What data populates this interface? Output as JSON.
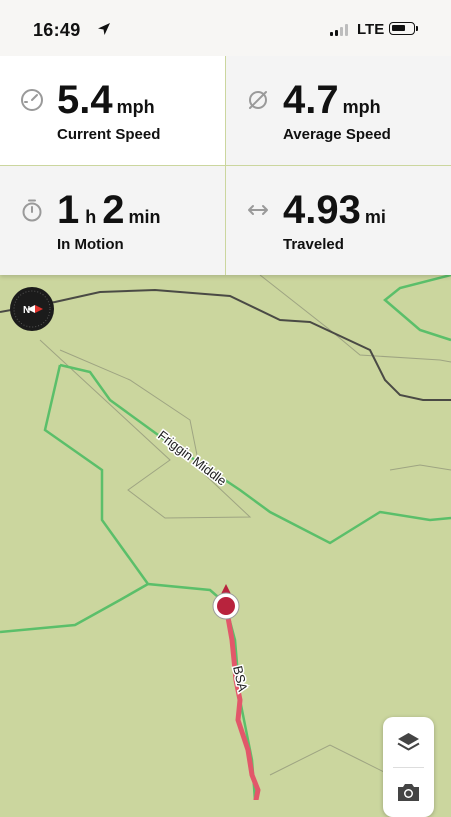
{
  "status_bar": {
    "time": "16:49",
    "network": "LTE"
  },
  "stats": [
    {
      "value": "5.4",
      "unit": "mph",
      "label": "Current Speed",
      "icon": "speedometer-icon"
    },
    {
      "value": "4.7",
      "unit": "mph",
      "label": "Average Speed",
      "icon": "average-icon"
    },
    {
      "hours": "1",
      "hours_unit": "h",
      "minutes": "2",
      "minutes_unit": "min",
      "label": "In Motion",
      "icon": "stopwatch-icon"
    },
    {
      "value": "4.93",
      "unit": "mi",
      "label": "Traveled",
      "icon": "distance-arrows-icon"
    }
  ],
  "map": {
    "trail_labels": [
      "Friggin Middle",
      "BSA"
    ],
    "colors": {
      "background": "#cbd69e",
      "trail": "#5bbf6a",
      "road": "#4a4a45",
      "track": "#e2576a",
      "position_marker": "#b8233d"
    }
  },
  "controls": {
    "compass_letter": "N",
    "layers_icon": "layers-icon",
    "camera_icon": "camera-icon"
  }
}
